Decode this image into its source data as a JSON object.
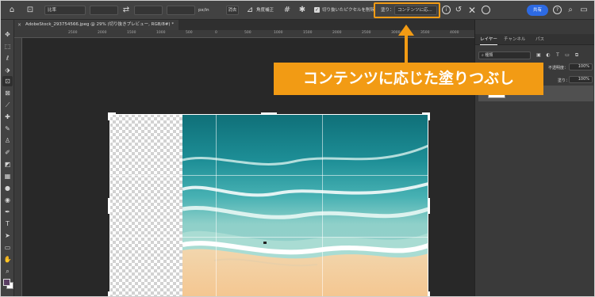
{
  "options_bar": {
    "ratio_label": "比率",
    "unit_label": "px/in",
    "clear_button": "消去",
    "straighten_label": "角度補正",
    "delete_cropped_label": "切り抜いたピクセルを削除",
    "fill_label": "塗り：",
    "fill_value": "コンテンツに応...",
    "share_button": "共有",
    "help_icon_text": "?"
  },
  "document_tab": {
    "title": "AdobeStock_293754566.jpeg @ 29% (切り抜きプレビュー, RGB/8#) *"
  },
  "ruler": {
    "top_labels": [
      "2500",
      "2000",
      "1500",
      "1000",
      "500",
      "0",
      "500",
      "1000",
      "1500",
      "2000",
      "2500",
      "3000",
      "3500",
      "4000",
      "4500",
      "5000"
    ]
  },
  "layers_panel": {
    "tabs": [
      "レイヤー",
      "チャンネル",
      "パス"
    ],
    "search_placeholder": "種類",
    "opacity_label": "不透明度：",
    "opacity_value": "100%",
    "fill_label": "塗り：",
    "fill_value": "100%"
  },
  "callout": {
    "text": "コンテンツに応じた塗りつぶし",
    "color": "#f29b14"
  },
  "colors": {
    "foreground": "#5a3d63",
    "background": "#ffffff",
    "share": "#2d6ae3"
  }
}
